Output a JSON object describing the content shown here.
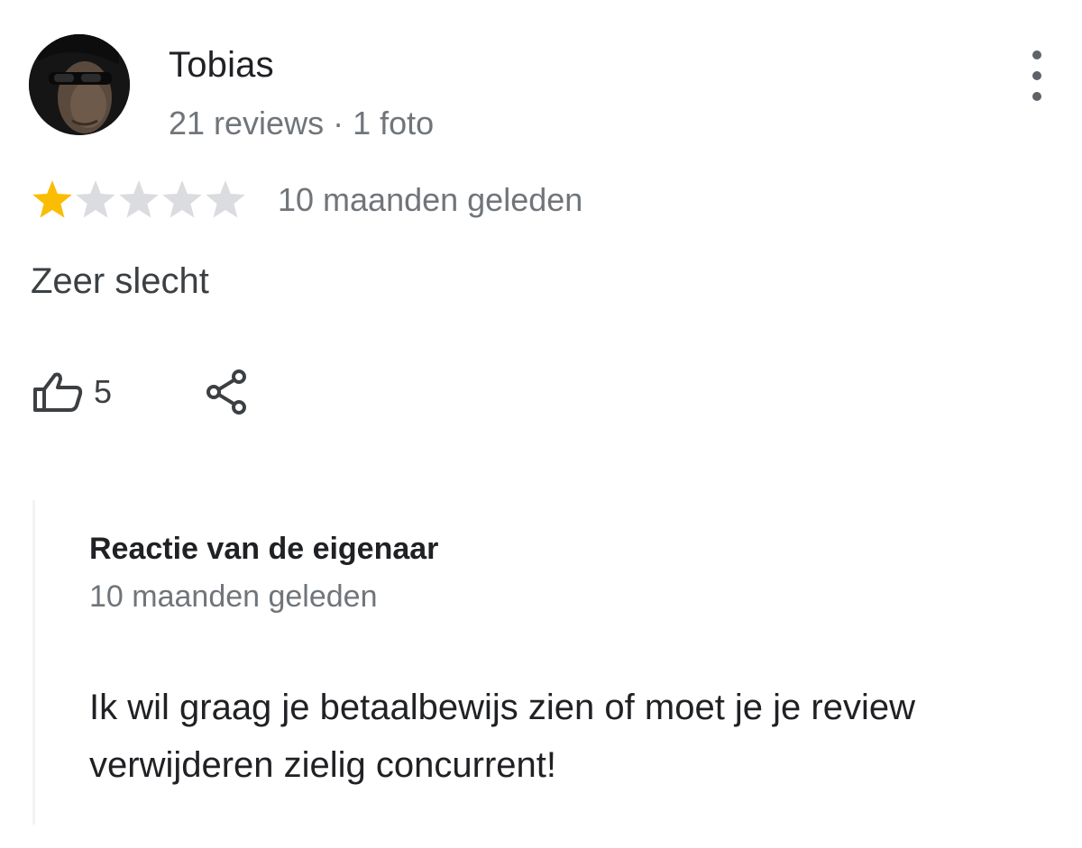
{
  "review": {
    "author": {
      "name": "Tobias",
      "meta": "21 reviews · 1 foto",
      "avatar": "avatar-photo"
    },
    "more_icon": "more-vert-icon",
    "rating": {
      "value": 1,
      "max": 5,
      "filled_color": "#fbbc04",
      "empty_color": "#dadce0"
    },
    "date": "10 maanden geleden",
    "text": "Zeer slecht",
    "likes": {
      "icon": "thumbs-up-icon",
      "count": "5"
    },
    "share_icon": "share-icon"
  },
  "owner_reply": {
    "title": "Reactie van de eigenaar",
    "date": "10 maanden geleden",
    "text": "Ik wil graag je betaalbewijs zien of moet je je review verwijderen zielig concurrent!"
  }
}
